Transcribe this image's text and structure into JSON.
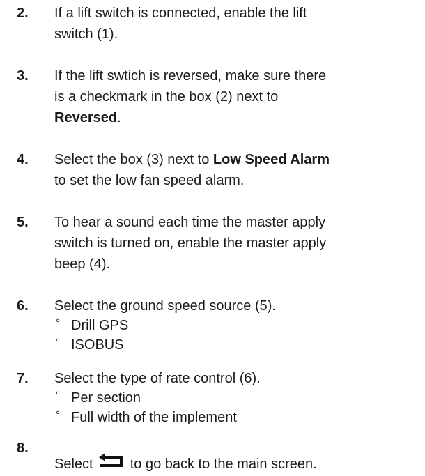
{
  "steps": [
    {
      "num": "2.",
      "line1": "If a lift switch is connected, enable the lift",
      "line2": "switch (1)."
    },
    {
      "num": "3.",
      "line1": "If the lift swtich is reversed, make sure there",
      "line2": "is a checkmark in the box (2) next to",
      "bold": "Reversed",
      "after": "."
    },
    {
      "num": "4.",
      "pre": "Select the box (3) next to ",
      "bold": "Low Speed Alarm",
      "line2": "to set the low fan speed alarm."
    },
    {
      "num": "5.",
      "line1": "To hear a sound each time the master apply",
      "line2": "switch is turned on, enable the master apply",
      "line3": "beep (4)."
    },
    {
      "num": "6.",
      "line1": "Select the ground speed source (5).",
      "options": [
        "Drill GPS",
        "ISOBUS"
      ]
    },
    {
      "num": "7.",
      "line1": "Select the type of rate control (6).",
      "options": [
        "Per section",
        "Full width of the implement"
      ]
    },
    {
      "num": "8.",
      "pre": "Select",
      "post": "to go back to the main screen.",
      "icon": "back-arrow-icon"
    }
  ],
  "bullet": "°"
}
